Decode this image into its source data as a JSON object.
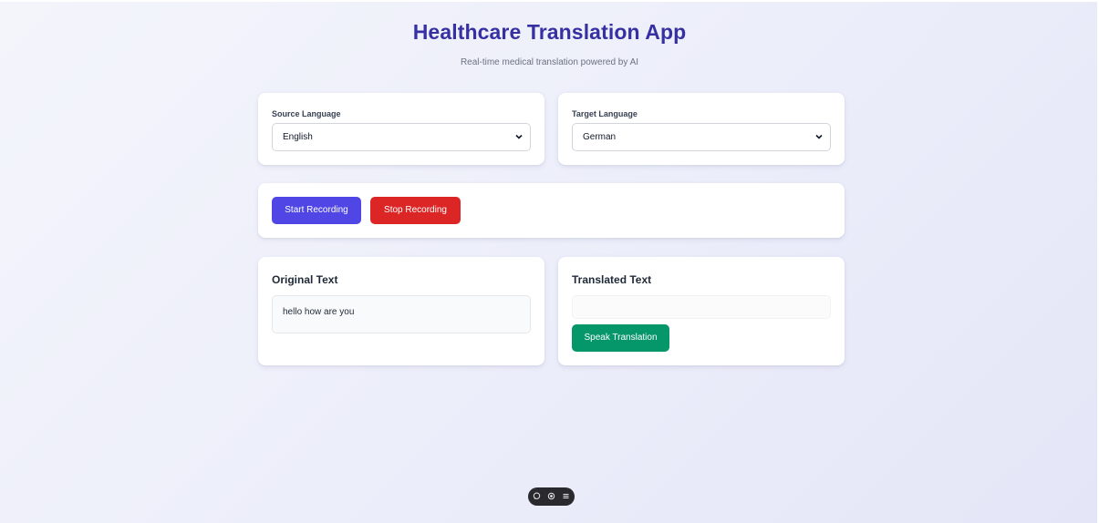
{
  "header": {
    "title": "Healthcare Translation App",
    "subtitle": "Real-time medical translation powered by AI"
  },
  "source": {
    "label": "Source Language",
    "selected": "English"
  },
  "target": {
    "label": "Target Language",
    "selected": "German"
  },
  "controls": {
    "start_label": "Start Recording",
    "stop_label": "Stop Recording"
  },
  "original": {
    "title": "Original Text",
    "text": "hello how are you"
  },
  "translated": {
    "title": "Translated Text",
    "text": "",
    "speak_label": "Speak Translation"
  },
  "colors": {
    "title": "#3730a3",
    "start_button": "#4f46e5",
    "stop_button": "#dc2626",
    "speak_button": "#059669"
  },
  "toolbar": {
    "icons": [
      "chat-icon",
      "toggle-icon",
      "menu-icon"
    ]
  }
}
